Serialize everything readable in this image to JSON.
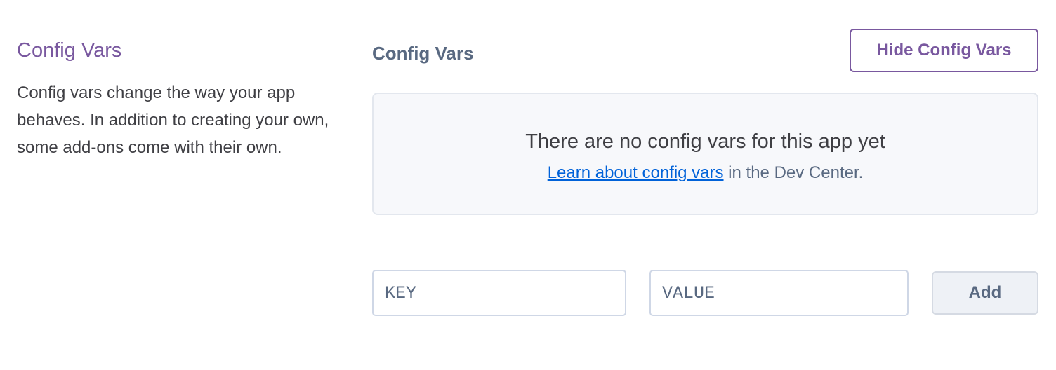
{
  "section": {
    "title": "Config Vars",
    "description": "Config vars change the way your app behaves. In addition to creating your own, some add-ons come with their own."
  },
  "config_vars": {
    "heading": "Config Vars",
    "hide_button_label": "Hide Config Vars",
    "empty_state": {
      "title": "There are no config vars for this app yet",
      "link_text": "Learn about config vars",
      "suffix_text": " in the Dev Center."
    },
    "new_var": {
      "key_placeholder": "KEY",
      "value_placeholder": "VALUE",
      "add_button_label": "Add"
    }
  },
  "colors": {
    "accent_purple": "#79589f",
    "link_blue": "#0062d9",
    "heading_slate": "#596981"
  }
}
